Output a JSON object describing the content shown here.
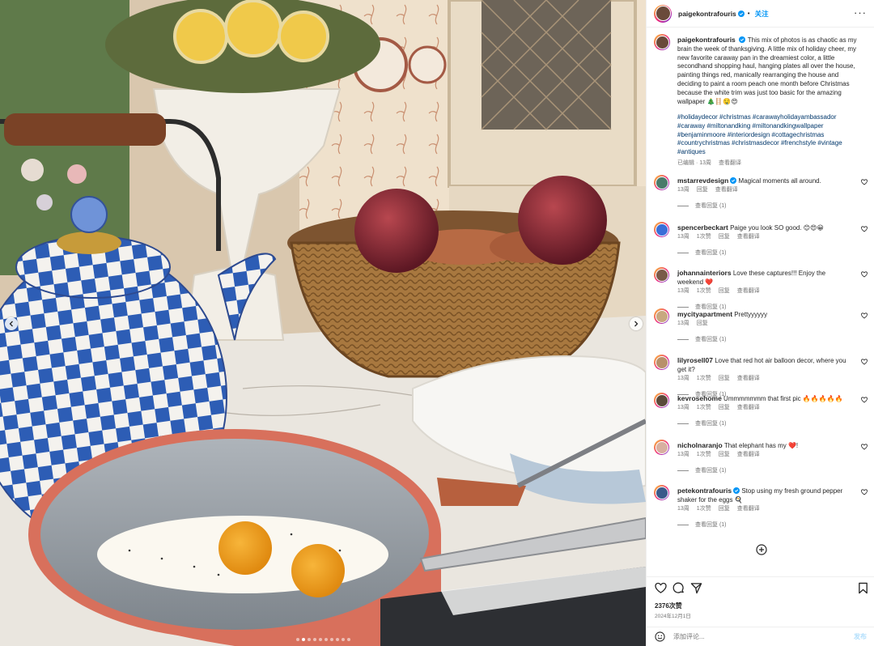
{
  "post": {
    "username": "paigekontrafouris",
    "follow_label": "关注",
    "separator": "•",
    "more_label": "···",
    "caption": "This mix of photos is as chaotic as my brain the week of thanksgiving. A little mix of holiday cheer, my new favorite caraway pan in the dreamiest color, a little secondhand shopping haul, hanging plates all over the house, painting things red, manically rearranging the house and deciding to paint a room peach one month before Christmas because the white trim was just too basic for the amazing wallpaper 🎄🪜🤤😍",
    "hashtags": "#holidaydecor #christmas #carawayholidayambassador #caraway #miltonandking #miltonandkingwallpaper #benjaminmoore #interiordesign #cottagechristmas #countrychristmas #christmasdecor #frenchstyle #vintage #antiques",
    "edited_label": "已编辑 · 13周",
    "translate_label": "查看翻译",
    "likes": "2376次赞",
    "date": "2024年12月1日",
    "comment_placeholder": "添加评论...",
    "post_button": "发布",
    "carousel_total": 10,
    "carousel_active": 1
  },
  "colors": {
    "accent": "#0095f6",
    "hashtag": "#00376b",
    "muted": "#737373"
  },
  "comments": [
    {
      "user": "mstarrevdesign",
      "verified": true,
      "text": "Magical moments all around.",
      "time": "13周",
      "likes": "",
      "reply": "回复",
      "translate": "查看翻译",
      "replies": "查看回复 (1)",
      "avatar_color": "#4a7a6a"
    },
    {
      "user": "spencerbeckart",
      "verified": false,
      "text": "Paige you look SO good. 😊😍😀",
      "time": "13周",
      "likes": "1次赞",
      "reply": "回复",
      "translate": "查看翻译",
      "replies": "查看回复 (1)",
      "avatar_color": "#3a6fd8"
    },
    {
      "user": "johannainteriors",
      "verified": false,
      "text": "Love these captures!!! Enjoy the weekend ❤️",
      "time": "13周",
      "likes": "1次赞",
      "reply": "回复",
      "translate": "查看翻译",
      "replies": "查看回复 (1)",
      "avatar_color": "#7a5a48"
    },
    {
      "user": "mycityapartment",
      "verified": false,
      "text": "Prettyyyyyy",
      "time": "13周",
      "likes": "",
      "reply": "回复",
      "translate": "",
      "replies": "查看回复 (1)",
      "avatar_color": "#c8a880"
    },
    {
      "user": "lilyrosell07",
      "verified": false,
      "text": "Love that red hot air balloon decor, where you get it?",
      "time": "13周",
      "likes": "1次赞",
      "reply": "回复",
      "translate": "查看翻译",
      "replies": "查看回复 (1)",
      "avatar_color": "#b8906a"
    },
    {
      "user": "kevrosehome",
      "verified": false,
      "text": "Ummmmmmm that first pic 🔥🔥🔥🔥🔥",
      "time": "13周",
      "likes": "1次赞",
      "reply": "回复",
      "translate": "查看翻译",
      "replies": "查看回复 (1)",
      "avatar_color": "#5a4a3a"
    },
    {
      "user": "nicholnaranjo",
      "verified": false,
      "text": "That elephant has my ❤️!",
      "time": "13周",
      "likes": "1次赞",
      "reply": "回复",
      "translate": "查看翻译",
      "replies": "查看回复 (1)",
      "avatar_color": "#d8b0a0"
    },
    {
      "user": "petekontrafouris",
      "verified": true,
      "text": "Stop using my fresh ground pepper shaker for the eggs 🍳",
      "time": "13周",
      "likes": "1次赞",
      "reply": "回复",
      "translate": "查看翻译",
      "replies": "查看回复 (1)",
      "avatar_color": "#3a5a8a"
    }
  ]
}
